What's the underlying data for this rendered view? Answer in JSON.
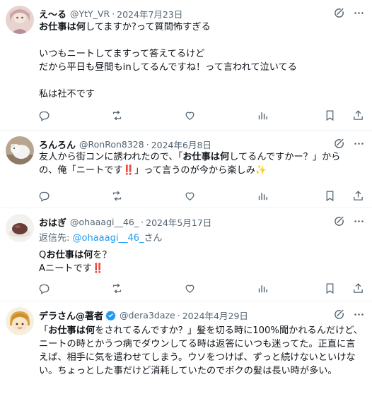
{
  "tweets": [
    {
      "name": "え〜る",
      "handle": "@YtY_VR",
      "sep": "·",
      "date": "2024年7月23日",
      "lines": [
        [
          {
            "t": "お仕事は何",
            "b": true
          },
          {
            "t": "してますか?って質問怖すぎる",
            "b": false
          }
        ],
        [],
        [
          {
            "t": "いつもニートしてますって答えてるけど",
            "b": false
          }
        ],
        [
          {
            "t": "だから平日も昼間もinしてるんですね！って言われて泣いてる",
            "b": false
          }
        ],
        [],
        [
          {
            "t": "私は社不です",
            "b": false
          }
        ]
      ]
    },
    {
      "name": "ろんろん",
      "handle": "@RonRon8328",
      "sep": "·",
      "date": "2024年6月8日",
      "lines": [
        [
          {
            "t": "友人から街コンに誘われたので、「",
            "b": false
          },
          {
            "t": "お仕事は何",
            "b": true
          },
          {
            "t": "してるんですかー？」から",
            "b": false
          }
        ],
        [
          {
            "t": "の、俺「ニートです",
            "b": false
          },
          {
            "t": "‼️",
            "b": false,
            "emoji": "red"
          },
          {
            "t": "」って言うのが今から楽しみ",
            "b": false
          },
          {
            "t": "✨",
            "b": false,
            "emoji": "gold"
          }
        ]
      ]
    },
    {
      "name": "おはぎ",
      "handle": "@ohaaagi__46_",
      "sep": "·",
      "date": "2024年5月17日",
      "reply_prefix": "返信先: ",
      "reply_handle": "@ohaaagi__46_",
      "reply_suffix": "さん",
      "lines": [
        [
          {
            "t": "Q",
            "b": false
          },
          {
            "t": "お仕事は何",
            "b": true
          },
          {
            "t": "を？",
            "b": false
          }
        ],
        [
          {
            "t": "Aニートです",
            "b": false
          },
          {
            "t": "‼️",
            "b": false,
            "emoji": "red"
          }
        ]
      ]
    },
    {
      "name": "デラさん@著者",
      "handle": "@dera3daze",
      "sep": "·",
      "date": "2024年4月29日",
      "lines": [
        [
          {
            "t": "「",
            "b": false
          },
          {
            "t": "お仕事は何",
            "b": true
          },
          {
            "t": "をされてるんですか？」髪を切る時に100%聞かれるんだけど、",
            "b": false
          }
        ],
        [
          {
            "t": "ニートの時とかうつ病でダウンしてる時は返答にいつも迷ってた。正直に言",
            "b": false
          }
        ],
        [
          {
            "t": "えば、相手に気を遣わせてしまう。ウソをつけば、ずっと続けないといけな",
            "b": false
          }
        ],
        [
          {
            "t": "い。ちょっとした事だけど消耗していたのでボクの髪は長い時が多い。",
            "b": false
          }
        ]
      ]
    }
  ],
  "icons": {
    "header": [
      "grok-icon",
      "more-icon"
    ],
    "actions": [
      "reply-icon",
      "retweet-icon",
      "like-icon",
      "views-icon",
      "bookmark-icon",
      "share-icon"
    ]
  },
  "colors": {
    "text": "#0f1419",
    "secondary": "#536471",
    "link": "#1d9bf0",
    "verified": "#1d9bf0",
    "divider": "#eff3f4"
  }
}
